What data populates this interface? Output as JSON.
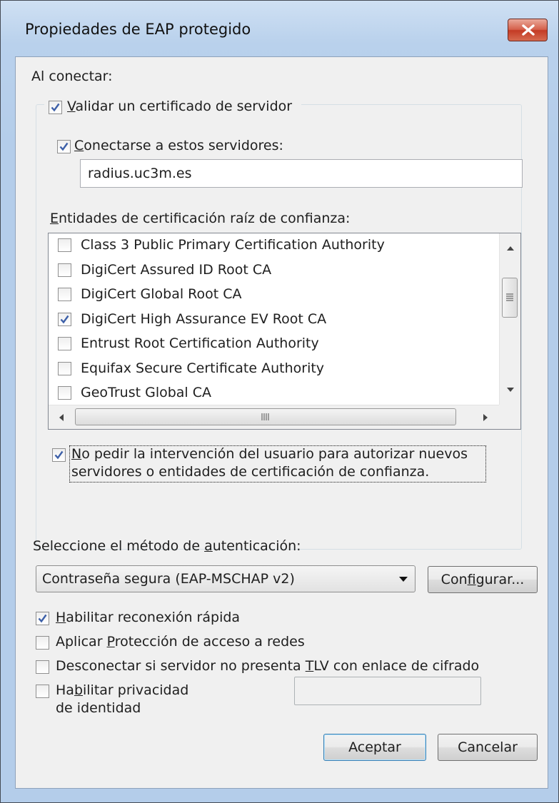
{
  "window": {
    "title": "Propiedades de EAP protegido"
  },
  "connect": {
    "heading": "Al conectar:",
    "validate_cert": {
      "checked": true,
      "pre": "",
      "accel": "V",
      "post": "alidar un certificado de servidor"
    },
    "connect_servers": {
      "checked": true,
      "pre": "",
      "accel": "C",
      "post": "onectarse a estos servidores:"
    },
    "servers_value": "radius.uc3m.es",
    "trusted_ca_label": {
      "pre": "",
      "accel": "E",
      "post": "ntidades de certificación raíz de confianza:"
    },
    "ca_list": [
      {
        "label": "Class 3 Public Primary Certification Authority",
        "checked": false
      },
      {
        "label": "DigiCert Assured ID Root CA",
        "checked": false
      },
      {
        "label": "DigiCert Global Root CA",
        "checked": false
      },
      {
        "label": "DigiCert High Assurance EV Root CA",
        "checked": true
      },
      {
        "label": "Entrust Root Certification Authority",
        "checked": false
      },
      {
        "label": "Equifax Secure Certificate Authority",
        "checked": false
      },
      {
        "label": "GeoTrust Global CA",
        "checked": false
      }
    ],
    "no_prompt": {
      "checked": true,
      "line1_pre": "",
      "line1_accel": "N",
      "line1_post": "o pedir la intervención del usuario para autorizar nuevos",
      "line2": "servidores o entidades de certificación de confianza."
    }
  },
  "auth": {
    "label": {
      "pre": "Seleccione el método de ",
      "accel": "a",
      "post": "utenticación:"
    },
    "selected_method": "Contraseña segura (EAP-MSCHAP v2)",
    "configure": {
      "pre": "Con",
      "accel": "f",
      "post": "igurar..."
    }
  },
  "options": {
    "fast_reconnect": {
      "checked": true,
      "pre": "",
      "accel": "H",
      "post": "abilitar reconexión rápida"
    },
    "nap": {
      "checked": false,
      "pre": "Aplicar ",
      "accel": "P",
      "post": "rotección de acceso a redes"
    },
    "tlv": {
      "checked": false,
      "pre": "Desconectar si servidor no presenta ",
      "accel": "T",
      "post": "LV con enlace de cifrado"
    },
    "privacy": {
      "checked": false,
      "line1_pre": "Ha",
      "line1_accel": "b",
      "line1_post": "ilitar privacidad",
      "line2": "de identidad"
    }
  },
  "buttons": {
    "ok": "Aceptar",
    "cancel": "Cancelar"
  },
  "icons": {
    "close": "close-icon",
    "check": "checkmark-icon",
    "dropdown": "chevron-down-icon"
  },
  "colors": {
    "title_gradient_top": "#cfe0f3",
    "close_button": "#c43b25",
    "checkmark": "#3c5fa8",
    "default_button_border": "#3c7fb1"
  }
}
